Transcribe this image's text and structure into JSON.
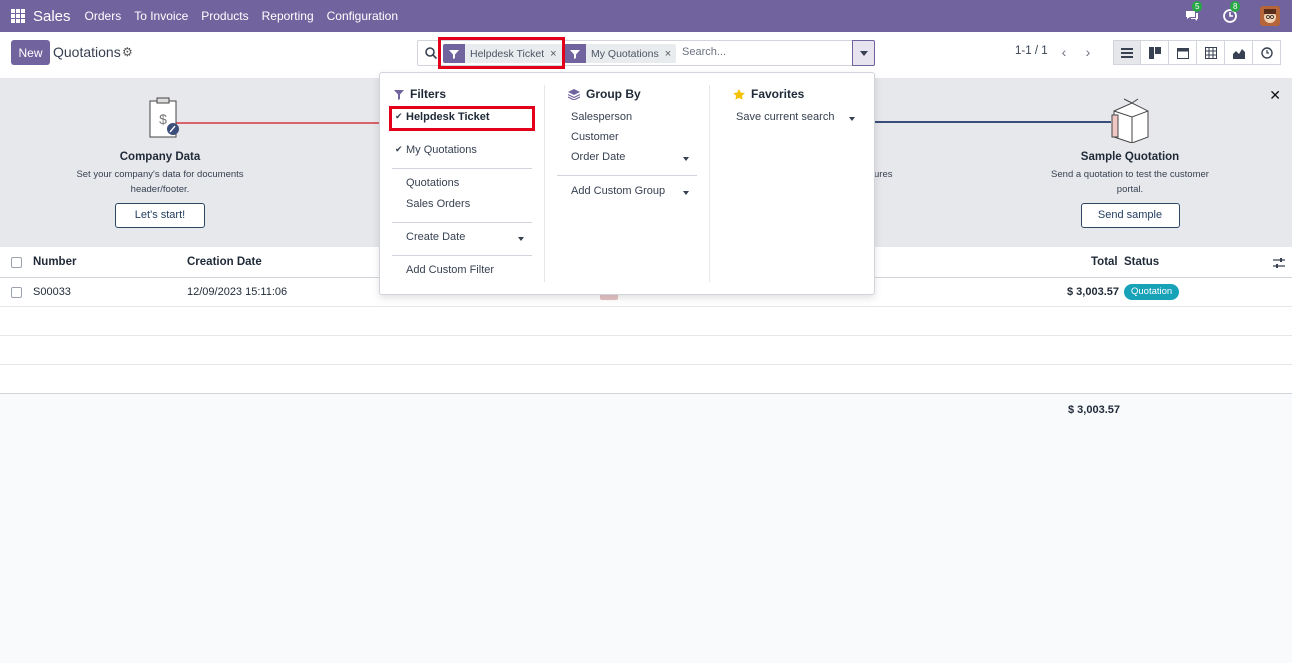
{
  "navbar": {
    "app_name": "Sales",
    "menu": [
      "Orders",
      "To Invoice",
      "Products",
      "Reporting",
      "Configuration"
    ],
    "messages_count": "5",
    "activities_count": "8"
  },
  "control_panel": {
    "new_label": "New",
    "title": "Quotations",
    "facets": [
      "Helpdesk Ticket",
      "My Quotations"
    ],
    "search_placeholder": "Search...",
    "pager": "1-1 / 1"
  },
  "helper": {
    "steps": [
      {
        "title": "Company Data",
        "desc": "Set your company's data for documents header/footer.",
        "button": "Let's start!"
      },
      {
        "title": "Sample Quotation",
        "desc": "Send a quotation to test the customer portal.",
        "button": "Send sample"
      }
    ],
    "partial_text": "ures"
  },
  "list": {
    "columns": {
      "number": "Number",
      "creation_date": "Creation Date",
      "total": "Total",
      "status": "Status"
    },
    "rows": [
      {
        "number": "S00033",
        "creation_date": "12/09/2023 15:11:06",
        "total": "$ 3,003.57",
        "status": "Quotation"
      }
    ],
    "footer_total": "$ 3,003.57"
  },
  "dropdown": {
    "filters": {
      "title": "Filters",
      "checked": [
        "Helpdesk Ticket",
        "My Quotations"
      ],
      "options": [
        "Quotations",
        "Sales Orders"
      ],
      "date_option": "Create Date",
      "custom": "Add Custom Filter"
    },
    "group_by": {
      "title": "Group By",
      "options": [
        "Salesperson",
        "Customer",
        "Order Date"
      ],
      "custom": "Add Custom Group"
    },
    "favorites": {
      "title": "Favorites",
      "save": "Save current search"
    }
  },
  "colors": {
    "brand": "#71639e",
    "highlight": "#e3001b",
    "status_badge": "#17a2b8"
  }
}
